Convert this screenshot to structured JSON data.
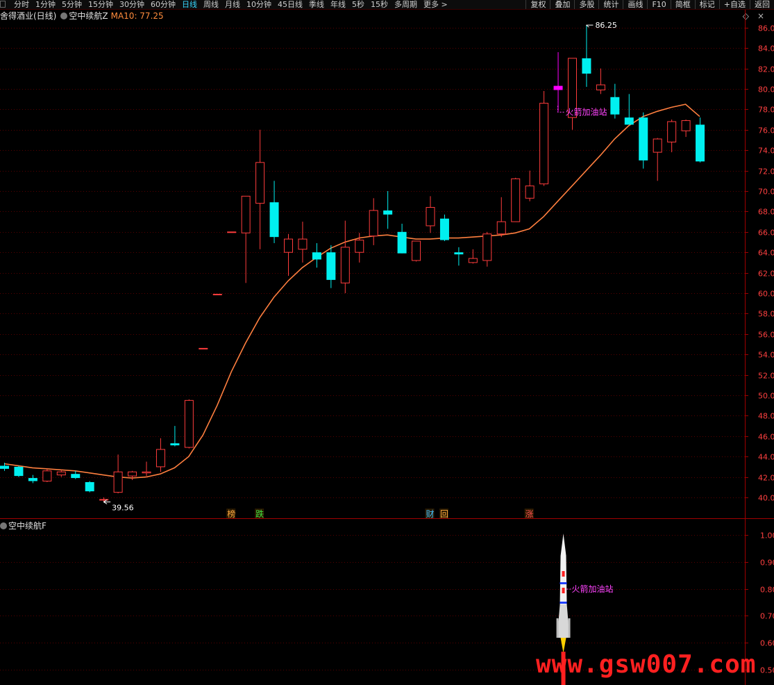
{
  "toolbar": {
    "periods": [
      "分时",
      "1分钟",
      "5分钟",
      "15分钟",
      "30分钟",
      "60分钟",
      "日线",
      "周线",
      "月线",
      "10分钟",
      "45日线",
      "季线",
      "年线",
      "5秒",
      "15秒",
      "多周期",
      "更多 >"
    ],
    "active_period": "日线",
    "tools": [
      "复权",
      "叠加",
      "多股",
      "统计",
      "画线",
      "F10",
      "简框",
      "标记",
      "+自选",
      "返回"
    ]
  },
  "main_panel": {
    "title": "舍得酒业(日线)",
    "indicator_name": "空中续航Z",
    "ma_label": "MA10: 77.25",
    "window_controls": [
      "◇",
      "×"
    ]
  },
  "sub_panel": {
    "indicator_name": "空中续航F",
    "signal_label": "火箭加油站",
    "y_ticks": [
      "1.00",
      "0.90",
      "0.80",
      "0.70",
      "0.60",
      "0.50"
    ]
  },
  "watermark": "www.gsw007.com",
  "colors": {
    "up": "#ff3c3c",
    "down": "#00f0f0",
    "ma": "#ff7f3f",
    "grid": "#5a0000",
    "axis": "#a00000",
    "signal": "#ff44ff",
    "magenta_candle": "#ff00ff"
  },
  "chart_data": {
    "type": "candlestick",
    "y_axis_ticks": [
      "86.00",
      "84.00",
      "82.00",
      "80.00",
      "78.00",
      "76.00",
      "74.00",
      "72.00",
      "70.00",
      "68.00",
      "66.00",
      "64.00",
      "62.00",
      "60.00",
      "58.00",
      "56.00",
      "54.00",
      "52.00",
      "50.00",
      "48.00",
      "46.00",
      "44.00",
      "42.00",
      "40.00"
    ],
    "ylim": [
      38.8,
      87.2
    ],
    "high_label": "86.25",
    "low_label": "39.56",
    "signal_label": "火箭加油站",
    "event_markers": [
      {
        "index": 16,
        "text": "榜",
        "color": "#ffaa40"
      },
      {
        "index": 18,
        "text": "跌",
        "color": "#40e040"
      },
      {
        "index": 30,
        "text": "财",
        "color": "#40c0ff"
      },
      {
        "index": 31,
        "text": "回",
        "color": "#ffaa40"
      },
      {
        "index": 37,
        "text": "涨",
        "color": "#ff5050"
      }
    ],
    "candles": [
      {
        "o": 43.1,
        "h": 43.4,
        "l": 42.6,
        "c": 42.8
      },
      {
        "o": 43.0,
        "h": 43.1,
        "l": 42.0,
        "c": 42.1
      },
      {
        "o": 41.9,
        "h": 42.2,
        "l": 41.4,
        "c": 41.6
      },
      {
        "o": 41.6,
        "h": 42.8,
        "l": 41.5,
        "c": 42.6
      },
      {
        "o": 42.2,
        "h": 42.7,
        "l": 42.0,
        "c": 42.5
      },
      {
        "o": 42.3,
        "h": 42.6,
        "l": 41.8,
        "c": 41.9
      },
      {
        "o": 41.5,
        "h": 41.6,
        "l": 40.5,
        "c": 40.6
      },
      {
        "o": 39.8,
        "h": 40.0,
        "l": 39.56,
        "c": 39.8
      },
      {
        "o": 40.5,
        "h": 44.2,
        "l": 40.4,
        "c": 42.5
      },
      {
        "o": 42.1,
        "h": 42.6,
        "l": 41.7,
        "c": 42.5
      },
      {
        "o": 42.4,
        "h": 43.5,
        "l": 42.1,
        "c": 42.5
      },
      {
        "o": 43.0,
        "h": 45.8,
        "l": 42.5,
        "c": 44.7
      },
      {
        "o": 45.3,
        "h": 47.0,
        "l": 45.0,
        "c": 45.1
      },
      {
        "o": 44.9,
        "h": 49.6,
        "l": 44.8,
        "c": 49.5
      },
      {
        "o": 54.6,
        "h": 54.6,
        "l": 54.6,
        "c": 54.6
      },
      {
        "o": 59.9,
        "h": 59.9,
        "l": 59.9,
        "c": 59.9
      },
      {
        "o": 66.0,
        "h": 66.0,
        "l": 66.0,
        "c": 66.0
      },
      {
        "o": 65.9,
        "h": 68.0,
        "l": 61.0,
        "c": 69.5
      },
      {
        "o": 68.8,
        "h": 76.0,
        "l": 64.3,
        "c": 72.8
      },
      {
        "o": 68.9,
        "h": 71.0,
        "l": 64.9,
        "c": 65.5
      },
      {
        "o": 64.0,
        "h": 65.8,
        "l": 61.7,
        "c": 65.3
      },
      {
        "o": 64.3,
        "h": 67.0,
        "l": 63.0,
        "c": 65.3
      },
      {
        "o": 64.0,
        "h": 64.9,
        "l": 62.5,
        "c": 63.3
      },
      {
        "o": 64.0,
        "h": 64.7,
        "l": 60.5,
        "c": 61.3
      },
      {
        "o": 61.0,
        "h": 67.1,
        "l": 60.0,
        "c": 64.5
      },
      {
        "o": 64.0,
        "h": 65.9,
        "l": 63.0,
        "c": 65.2
      },
      {
        "o": 65.6,
        "h": 69.3,
        "l": 64.7,
        "c": 68.1
      },
      {
        "o": 68.1,
        "h": 70.0,
        "l": 66.3,
        "c": 67.7
      },
      {
        "o": 66.0,
        "h": 66.8,
        "l": 63.9,
        "c": 63.9
      },
      {
        "o": 63.2,
        "h": 65.1,
        "l": 63.1,
        "c": 65.1
      },
      {
        "o": 66.6,
        "h": 69.5,
        "l": 65.9,
        "c": 68.4
      },
      {
        "o": 67.3,
        "h": 67.7,
        "l": 65.1,
        "c": 65.2
      },
      {
        "o": 64.0,
        "h": 64.5,
        "l": 62.7,
        "c": 63.8
      },
      {
        "o": 63.0,
        "h": 64.3,
        "l": 62.9,
        "c": 63.4
      },
      {
        "o": 63.2,
        "h": 66.0,
        "l": 62.6,
        "c": 65.8
      },
      {
        "o": 65.8,
        "h": 69.4,
        "l": 65.5,
        "c": 67.0
      },
      {
        "o": 67.0,
        "h": 71.3,
        "l": 67.0,
        "c": 71.2
      },
      {
        "o": 69.3,
        "h": 72.0,
        "l": 69.0,
        "c": 70.5
      },
      {
        "o": 70.7,
        "h": 79.8,
        "l": 70.5,
        "c": 78.6
      },
      {
        "o": 80.3,
        "h": 83.6,
        "l": 77.8,
        "c": 80.1,
        "special": "magenta"
      },
      {
        "o": 77.2,
        "h": 83.0,
        "l": 76.0,
        "c": 83.0
      },
      {
        "o": 83.0,
        "h": 86.25,
        "l": 80.2,
        "c": 81.5
      },
      {
        "o": 79.9,
        "h": 82.0,
        "l": 79.5,
        "c": 80.4
      },
      {
        "o": 79.2,
        "h": 80.5,
        "l": 77.1,
        "c": 77.5
      },
      {
        "o": 77.2,
        "h": 79.5,
        "l": 76.5,
        "c": 76.5
      },
      {
        "o": 77.2,
        "h": 77.7,
        "l": 72.2,
        "c": 73.0
      },
      {
        "o": 73.8,
        "h": 75.2,
        "l": 71.0,
        "c": 75.1
      },
      {
        "o": 74.8,
        "h": 77.0,
        "l": 73.8,
        "c": 76.8
      },
      {
        "o": 75.9,
        "h": 77.0,
        "l": 75.3,
        "c": 76.9
      },
      {
        "o": 76.5,
        "h": 77.2,
        "l": 72.8,
        "c": 72.9
      }
    ],
    "ma10": [
      43.3,
      43.1,
      42.9,
      42.8,
      42.7,
      42.6,
      42.4,
      42.2,
      42.0,
      41.9,
      42.0,
      42.3,
      42.9,
      44.0,
      46.1,
      49.0,
      52.3,
      55.1,
      57.6,
      59.6,
      61.2,
      62.5,
      63.5,
      64.4,
      65.0,
      65.4,
      65.6,
      65.7,
      65.5,
      65.3,
      65.3,
      65.4,
      65.4,
      65.5,
      65.6,
      65.7,
      65.9,
      66.3,
      67.5,
      69.0,
      70.5,
      72.0,
      73.5,
      75.1,
      76.4,
      77.3,
      77.8,
      78.2,
      78.5,
      77.3
    ]
  }
}
